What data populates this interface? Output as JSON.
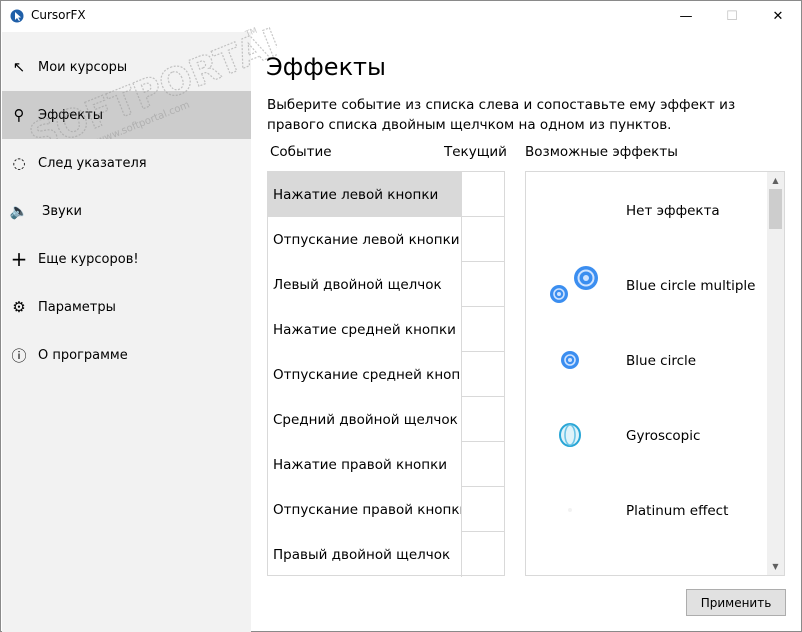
{
  "window": {
    "title": "CursorFX",
    "minimize": "—",
    "maximize": "☐",
    "close": "✕"
  },
  "watermark": {
    "text": "SOFTPORTAL",
    "url": "www.softportal.com",
    "tm": "TM"
  },
  "sidebar": {
    "items": [
      {
        "label": "Мои курсоры",
        "icon": "cursor-arrow-icon",
        "glyph": "↖"
      },
      {
        "label": "Эффекты",
        "icon": "magic-wand-icon",
        "glyph": "⚲"
      },
      {
        "label": "След указателя",
        "icon": "trail-icon",
        "glyph": "◌"
      },
      {
        "label": "Звуки",
        "icon": "speaker-icon",
        "glyph": "🔈"
      },
      {
        "label": "Еще курсоров!",
        "icon": "plus-icon",
        "glyph": "+"
      },
      {
        "label": "Параметры",
        "icon": "gear-icon",
        "glyph": "⚙"
      },
      {
        "label": "О программе",
        "icon": "info-icon",
        "glyph": "ⓘ"
      }
    ],
    "active_index": 1
  },
  "main": {
    "title": "Эффекты",
    "description": "Выберите событие из списка слева и сопоставьте ему эффект из правого списка двойным щелчком на одном из пунктов.",
    "col_event": "Событие",
    "col_current": "Текущий",
    "col_effects": "Возможные эффекты"
  },
  "events": [
    "Нажатие левой кнопки",
    "Отпускание левой кнопки",
    "Левый двойной щелчок",
    "Нажатие средней кнопки",
    "Отпускание средней кнопки",
    "Средний двойной щелчок",
    "Нажатие правой кнопки",
    "Отпускание правой кнопки",
    "Правый двойной щелчок"
  ],
  "selected_event_index": 0,
  "effects": [
    {
      "name": "Нет эффекта",
      "icon": "none"
    },
    {
      "name": "Blue circle multiple",
      "icon": "blue-circle-multiple-icon"
    },
    {
      "name": "Blue circle",
      "icon": "blue-circle-icon"
    },
    {
      "name": "Gyroscopic",
      "icon": "gyroscopic-icon"
    },
    {
      "name": "Platinum effect",
      "icon": "platinum-effect-icon"
    }
  ],
  "scroll": {
    "up": "▲",
    "down": "▼"
  },
  "apply_label": "Применить",
  "colors": {
    "sidebar_bg": "#f2f2f2",
    "active_bg": "#cccccc",
    "selected_row": "#d9d9d9",
    "effect_blue": "#2f7fe0"
  }
}
